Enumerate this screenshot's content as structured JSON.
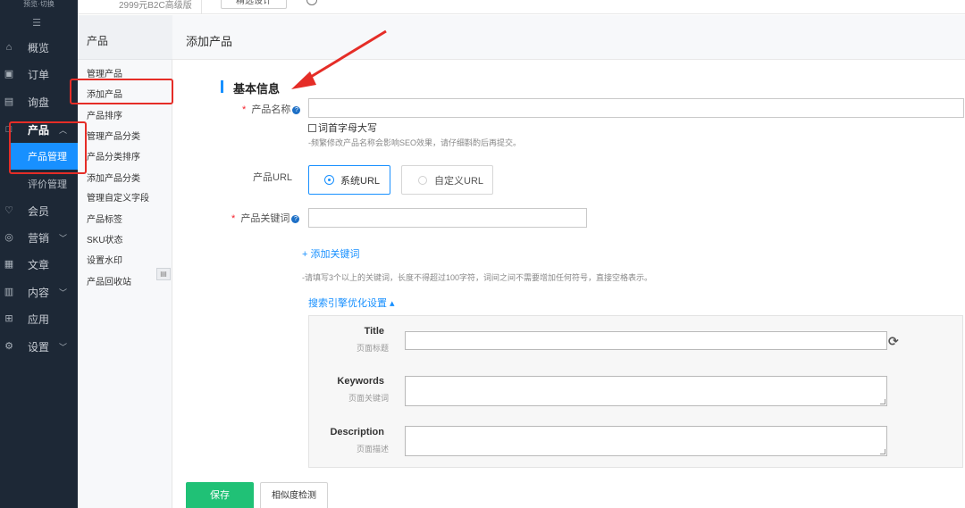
{
  "brand": "预览·切换",
  "topbar": {
    "version": "2999元B2C高级版",
    "button": "精选设计"
  },
  "nav": {
    "items": [
      {
        "label": "概览",
        "icon": "home-icon"
      },
      {
        "label": "订单",
        "icon": "order-icon"
      },
      {
        "label": "询盘",
        "icon": "inquiry-icon"
      },
      {
        "label": "产品",
        "icon": "product-icon",
        "arrow": "^"
      },
      {
        "label": "会员",
        "icon": "member-icon"
      },
      {
        "label": "营销",
        "icon": "marketing-icon",
        "arrow": "v"
      },
      {
        "label": "文章",
        "icon": "article-icon"
      },
      {
        "label": "内容",
        "icon": "content-icon",
        "arrow": "v"
      },
      {
        "label": "应用",
        "icon": "apps-icon"
      },
      {
        "label": "设置",
        "icon": "settings-icon",
        "arrow": "v"
      }
    ],
    "sub_active": "产品管理",
    "sub_other": "评价管理"
  },
  "subnav": {
    "head": "产品",
    "items": [
      "管理产品",
      "添加产品",
      "产品排序",
      "管理产品分类",
      "产品分类排序",
      "添加产品分类",
      "管理自定义字段",
      "产品标签",
      "SKU状态",
      "设置水印",
      "产品回收站"
    ]
  },
  "main": {
    "title": "添加产品",
    "section_title": "基本信息",
    "product_name_label": "产品名称",
    "capitalize_label": "词首字母大写",
    "name_hint": "-频繁修改产品名称会影响SEO效果，请仔细斟酌后再提交。",
    "url_label": "产品URL",
    "url_system": "系统URL",
    "url_custom": "自定义URL",
    "keyword_label": "产品关键词",
    "add_keyword": "+ 添加关键词",
    "keyword_hint": "-请填写3个以上的关键词，长度不得超过100字符，词间之间不需要增加任何符号，直接空格表示。",
    "seo_toggle": "搜索引擎优化设置 ▴",
    "seo": {
      "title_label": "Title",
      "title_sub": "页面标题",
      "keywords_label": "Keywords",
      "keywords_sub": "页面关键词",
      "description_label": "Description",
      "description_sub": "页面描述"
    },
    "save": "保存",
    "preview": "相似度检测"
  },
  "colors": {
    "nav_bg": "#1d2836",
    "accent": "#1890ff",
    "save": "#20c176",
    "annotation": "#e52d27"
  }
}
